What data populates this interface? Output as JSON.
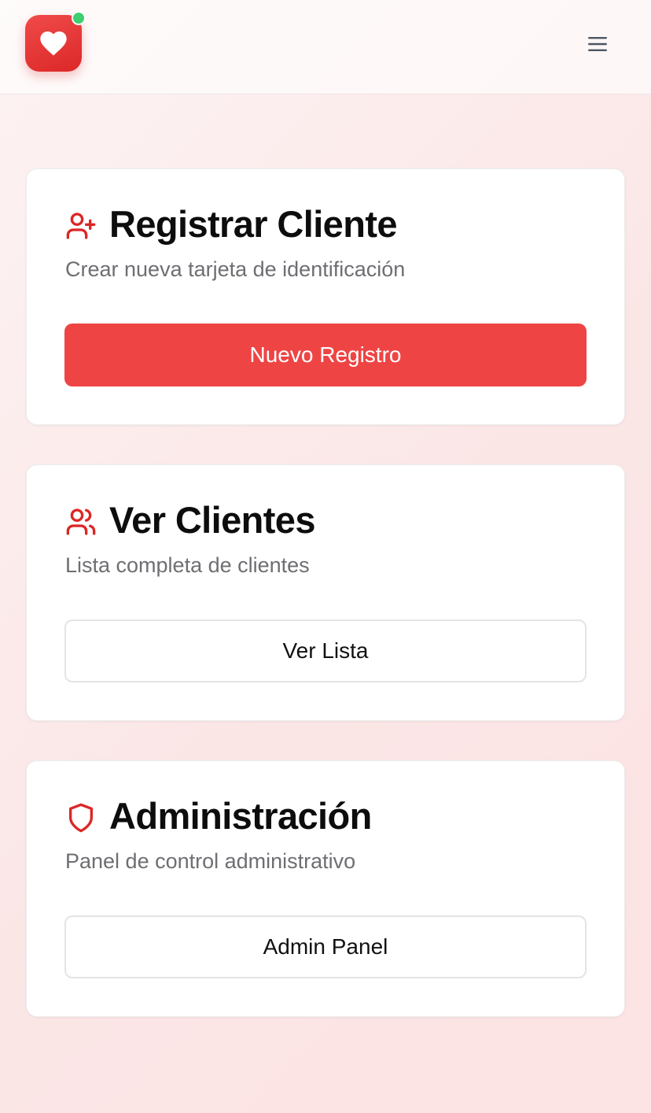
{
  "header": {
    "logo_icon": "heart-icon",
    "status_color": "#3ecf6e",
    "menu_icon": "hamburger-menu-icon"
  },
  "colors": {
    "accent": "#ef4444",
    "icon_red": "#dc2626"
  },
  "cards": [
    {
      "icon": "user-plus-icon",
      "title": "Registrar Cliente",
      "subtitle": "Crear nueva tarjeta de identificación",
      "button": "Nuevo Registro",
      "button_style": "primary"
    },
    {
      "icon": "users-icon",
      "title": "Ver Clientes",
      "subtitle": "Lista completa de clientes",
      "button": "Ver Lista",
      "button_style": "outline"
    },
    {
      "icon": "shield-icon",
      "title": "Administración",
      "subtitle": "Panel de control administrativo",
      "button": "Admin Panel",
      "button_style": "outline"
    }
  ]
}
